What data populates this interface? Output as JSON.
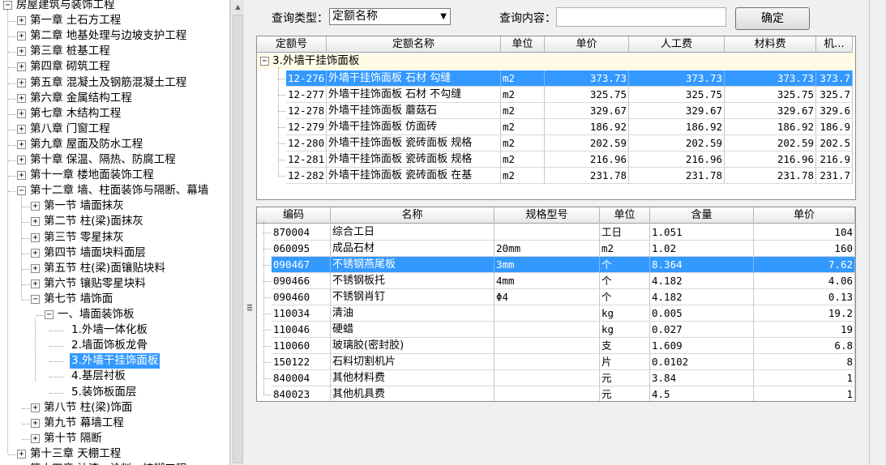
{
  "tree": {
    "root": "房屋建筑与装饰工程",
    "chapters": [
      {
        "label": "第一章  土石方工程"
      },
      {
        "label": "第二章  地基处理与边坡支护工程"
      },
      {
        "label": "第三章  桩基工程"
      },
      {
        "label": "第四章  砌筑工程"
      },
      {
        "label": "第五章  混凝土及钢筋混凝土工程"
      },
      {
        "label": "第六章  金属结构工程"
      },
      {
        "label": "第七章  木结构工程"
      },
      {
        "label": "第八章  门窗工程"
      },
      {
        "label": "第九章  屋面及防水工程"
      },
      {
        "label": "第十章  保温、隔热、防腐工程"
      },
      {
        "label": "第十一章  楼地面装饰工程"
      },
      {
        "label": "第十二章  墙、柱面装饰与隔断、幕墙"
      },
      {
        "label": "第十三章  天棚工程"
      },
      {
        "label": "第十四章  油漆、涂料、裱糊工程"
      }
    ],
    "sections": [
      {
        "label": "第一节  墙面抹灰"
      },
      {
        "label": "第二节  柱(梁)面抹灰"
      },
      {
        "label": "第三节  零星抹灰"
      },
      {
        "label": "第四节  墙面块料面层"
      },
      {
        "label": "第五节  柱(梁)面镶贴块料"
      },
      {
        "label": "第六节  镶贴零星块料"
      },
      {
        "label": "第七节  墙饰面"
      },
      {
        "label": "第八节  柱(梁)饰面"
      },
      {
        "label": "第九节  幕墙工程"
      },
      {
        "label": "第十节  隔断"
      }
    ],
    "subsection": "一、墙面装饰板",
    "leaves": [
      "1.外墙一体化板",
      "2.墙面饰板龙骨",
      "3.外墙干挂饰面板",
      "4.基层衬板",
      "5.装饰板面层"
    ]
  },
  "query": {
    "type_label": "查询类型：",
    "type_value": "定额名称",
    "content_label": "查询内容：",
    "content_value": "",
    "confirm_label": "确定"
  },
  "quota_table": {
    "columns": [
      "定额号",
      "定额名称",
      "单位",
      "单价",
      "人工费",
      "材料费",
      "机..."
    ],
    "group": "3.外墙干挂饰面板",
    "rows": [
      {
        "code": "12-276",
        "name": "外墙干挂饰面板 石材 勾缝",
        "unit": "m2",
        "price": "373.73",
        "labor": "373.73",
        "material": "373.73",
        "machine": "373.7"
      },
      {
        "code": "12-277",
        "name": "外墙干挂饰面板 石材 不勾缝",
        "unit": "m2",
        "price": "325.75",
        "labor": "325.75",
        "material": "325.75",
        "machine": "325.7"
      },
      {
        "code": "12-278",
        "name": "外墙干挂饰面板 蘑菇石",
        "unit": "m2",
        "price": "329.67",
        "labor": "329.67",
        "material": "329.67",
        "machine": "329.6"
      },
      {
        "code": "12-279",
        "name": "外墙干挂饰面板 仿面砖",
        "unit": "m2",
        "price": "186.92",
        "labor": "186.92",
        "material": "186.92",
        "machine": "186.9"
      },
      {
        "code": "12-280",
        "name": "外墙干挂饰面板 瓷砖面板 规格",
        "unit": "m2",
        "price": "202.59",
        "labor": "202.59",
        "material": "202.59",
        "machine": "202.5"
      },
      {
        "code": "12-281",
        "name": "外墙干挂饰面板 瓷砖面板 规格",
        "unit": "m2",
        "price": "216.96",
        "labor": "216.96",
        "material": "216.96",
        "machine": "216.9"
      },
      {
        "code": "12-282",
        "name": "外墙干挂饰面板 瓷砖面板 在基",
        "unit": "m2",
        "price": "231.78",
        "labor": "231.78",
        "material": "231.78",
        "machine": "231.7"
      }
    ]
  },
  "material_table": {
    "columns": [
      "编码",
      "名称",
      "规格型号",
      "单位",
      "含量",
      "单价"
    ],
    "rows": [
      {
        "code": "870004",
        "name": "综合工日",
        "spec": "",
        "unit": "工日",
        "qty": "1.051",
        "price": "104"
      },
      {
        "code": "060095",
        "name": "成品石材",
        "spec": "20mm",
        "unit": "m2",
        "qty": "1.02",
        "price": "160"
      },
      {
        "code": "090467",
        "name": "不锈钢燕尾板",
        "spec": "3mm",
        "unit": "个",
        "qty": "8.364",
        "price": "7.62"
      },
      {
        "code": "090466",
        "name": "不锈钢板托",
        "spec": "4mm",
        "unit": "个",
        "qty": "4.182",
        "price": "4.06"
      },
      {
        "code": "090460",
        "name": "不锈钢肖钉",
        "spec": "Φ4",
        "unit": "个",
        "qty": "4.182",
        "price": "0.13"
      },
      {
        "code": "110034",
        "name": "清油",
        "spec": "",
        "unit": "kg",
        "qty": "0.005",
        "price": "19.2"
      },
      {
        "code": "110046",
        "name": "硬蜡",
        "spec": "",
        "unit": "kg",
        "qty": "0.027",
        "price": "19"
      },
      {
        "code": "110060",
        "name": "玻璃胶(密封胶)",
        "spec": "",
        "unit": "支",
        "qty": "1.609",
        "price": "6.8"
      },
      {
        "code": "150122",
        "name": "石料切割机片",
        "spec": "",
        "unit": "片",
        "qty": "0.0102",
        "price": "8"
      },
      {
        "code": "840004",
        "name": "其他材料费",
        "spec": "",
        "unit": "元",
        "qty": "3.84",
        "price": "1"
      },
      {
        "code": "840023",
        "name": "其他机具费",
        "spec": "",
        "unit": "元",
        "qty": "4.5",
        "price": "1"
      }
    ]
  },
  "colors": {
    "selection": "#3399ff",
    "group_row": "#fffbe6"
  },
  "icons": {
    "expand": "plus-box-icon",
    "collapse": "minus-box-icon",
    "dropdown": "chevron-down-icon",
    "splitter": "grip-icon"
  }
}
